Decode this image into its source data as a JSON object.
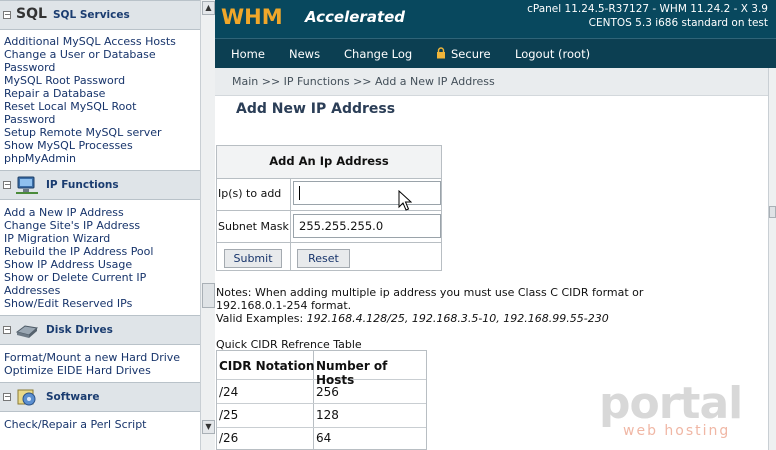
{
  "left": {
    "sections": [
      {
        "title": "SQL Services",
        "prefix": "SQL",
        "icon": "sql-icon",
        "links": [
          "Additional MySQL Access Hosts",
          "Change a User or Database Password",
          "MySQL Root Password",
          "Repair a Database",
          "Reset Local MySQL Root Password",
          "Setup Remote MySQL server",
          "Show MySQL Processes",
          "phpMyAdmin"
        ]
      },
      {
        "title": "IP Functions",
        "icon": "network-icon",
        "links": [
          "Add a New IP Address",
          "Change Site's IP Address",
          "IP Migration Wizard",
          "Rebuild the IP Address Pool",
          "Show IP Address Usage",
          "Show or Delete Current IP Addresses",
          "Show/Edit Reserved IPs"
        ]
      },
      {
        "title": "Disk Drives",
        "icon": "disk-icon",
        "links": [
          "Format/Mount a new Hard Drive",
          "Optimize EIDE Hard Drives"
        ]
      },
      {
        "title": "Software",
        "icon": "software-icon",
        "links": [
          "Check/Repair a Perl Script"
        ]
      }
    ]
  },
  "header": {
    "logo_main": "WHM",
    "logo_sub": "Accelerated",
    "version_line1": "cPanel 11.24.5-R37127 - WHM 11.24.2 - X 3.9",
    "version_line2": "CENTOS 5.3 i686 standard on test"
  },
  "nav": {
    "items": [
      "Home",
      "News",
      "Change Log",
      "Secure",
      "Logout (root)"
    ]
  },
  "breadcrumb": "Main >> IP Functions >> Add a New IP Address",
  "page_title": "Add New IP Address",
  "form": {
    "heading": "Add An Ip Address",
    "ip_label": "Ip(s) to add",
    "ip_value": "",
    "mask_label": "Subnet Mask",
    "mask_value": "255.255.255.0",
    "submit": "Submit",
    "reset": "Reset"
  },
  "notes": {
    "line1": "Notes: When adding multiple ip address you must use Class C CIDR format or",
    "line2": "192.168.0.1-254 format.",
    "valid_prefix": "Valid Examples: ",
    "valid_examples": "192.168.4.128/25, 192.168.3.5-10, 192.168.99.55-230",
    "quick_title": "Quick CIDR Refrence Table"
  },
  "cidr": {
    "headers": [
      "CIDR Notation",
      "Number of Hosts"
    ],
    "rows": [
      [
        "/24",
        "256"
      ],
      [
        "/25",
        "128"
      ],
      [
        "/26",
        "64"
      ]
    ]
  },
  "watermark": {
    "main": "portal",
    "sub": "web hosting"
  },
  "colors": {
    "topbar": "#08485e",
    "logo_orange": "#f0a72a",
    "link": "#17346b"
  }
}
